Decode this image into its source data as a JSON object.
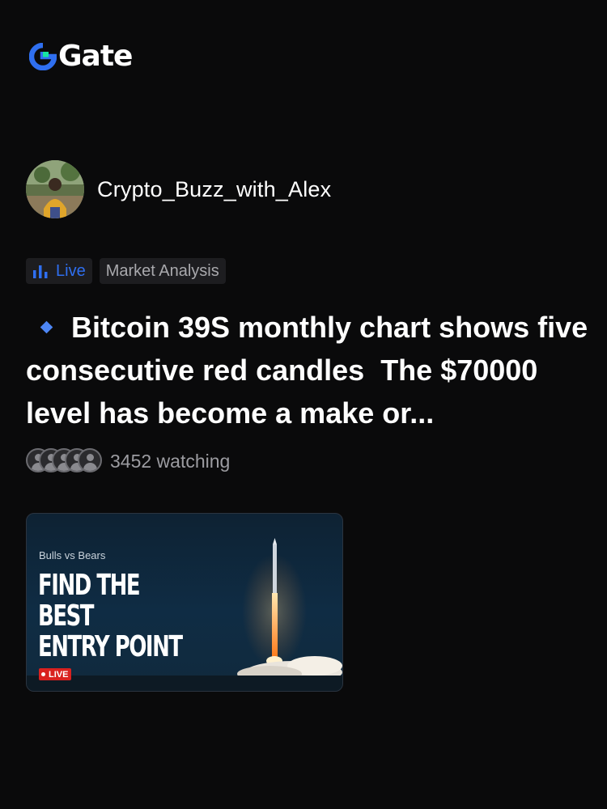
{
  "brand": {
    "name": "Gate",
    "logo_icon": "gate-logo-icon"
  },
  "author": {
    "name": "Crypto_Buzz_with_Alex",
    "avatar_icon": "avatar"
  },
  "tags": {
    "live_label": "Live",
    "live_icon": "bar-chart-icon",
    "category_label": "Market Analysis"
  },
  "post": {
    "bullet_icon": "diamond-icon",
    "title": "Bitcoin 39S monthly chart shows five consecutive red candles  The $70000 level has become a make or..."
  },
  "watching": {
    "text": "3452 watching",
    "avatar_count": 5
  },
  "thumbnail": {
    "subtitle": "Bulls vs Bears",
    "headline_line1": "FIND THE BEST",
    "headline_line2": "ENTRY POINT",
    "live_badge": "LIVE",
    "art": "rocket-launch-illustration"
  },
  "colors": {
    "background": "#0a0a0b",
    "accent_blue": "#2f6ff0",
    "logo_green": "#17e6a1",
    "live_red": "#d9211f"
  }
}
